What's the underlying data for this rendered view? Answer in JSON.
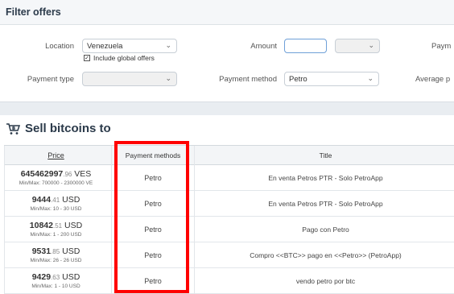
{
  "filter": {
    "title": "Filter offers",
    "location_label": "Location",
    "location_value": "Venezuela",
    "include_global_label": "Include global offers",
    "include_global_checked": true,
    "amount_label": "Amount",
    "amount_value": "",
    "payment_label_cut": "Paym",
    "payment_type_label": "Payment type",
    "payment_type_value": "",
    "payment_method_label": "Payment method",
    "payment_method_value": "Petro",
    "average_label_cut": "Average p"
  },
  "sell": {
    "title": "Sell bitcoins to",
    "icon": "cart-bitcoin-icon"
  },
  "table": {
    "headers": {
      "price": "Price",
      "payment_methods": "Payment methods",
      "title": "Title"
    },
    "rows": [
      {
        "price_int": "645462997",
        "price_dec": ".96",
        "currency": "VES",
        "minmax": "Min/Max: 700000 - 2300000 VE",
        "method": "Petro",
        "title": "En venta Petros PTR - Solo PetroApp"
      },
      {
        "price_int": "9444",
        "price_dec": ".41",
        "currency": "USD",
        "minmax": "Min/Max: 10 - 30 USD",
        "method": "Petro",
        "title": "En venta Petros PTR - Solo PetroApp"
      },
      {
        "price_int": "10842",
        "price_dec": ".51",
        "currency": "USD",
        "minmax": "Min/Max: 1 - 200 USD",
        "method": "Petro",
        "title": "Pago con Petro"
      },
      {
        "price_int": "9531",
        "price_dec": ".85",
        "currency": "USD",
        "minmax": "Min/Max: 26 - 26 USD",
        "method": "Petro",
        "title": "Compro <<BTC>> pago en <<Petro>> (PetroApp)"
      },
      {
        "price_int": "9429",
        "price_dec": ".63",
        "currency": "USD",
        "minmax": "Min/Max: 1 - 10 USD",
        "method": "Petro",
        "title": "vendo petro por btc"
      }
    ]
  },
  "colors": {
    "highlight": "#ff0000",
    "header_bg": "#f5f7f9",
    "band": "#e9edf1"
  }
}
